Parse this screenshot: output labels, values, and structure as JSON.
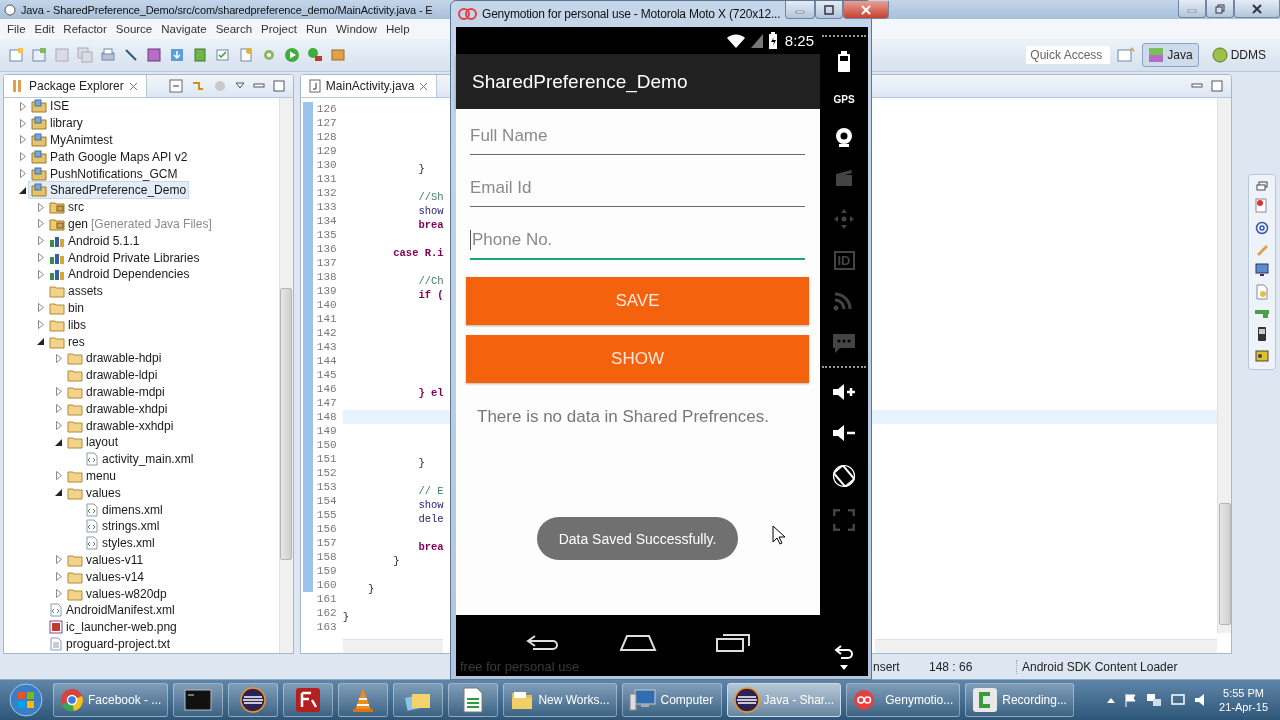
{
  "eclipse": {
    "title": "Java - SharedPreference_Demo/src/com/sharedpreference_demo/MainActivity.java - E",
    "menu": [
      "File",
      "Edit",
      "Refactor",
      "Source",
      "Navigate",
      "Search",
      "Project",
      "Run",
      "Window",
      "Help"
    ],
    "quick_access": {
      "placeholder": "Quick Access"
    },
    "perspectives": [
      {
        "label": "Java",
        "selected": true
      },
      {
        "label": "DDMS",
        "selected": false
      }
    ],
    "explorer": {
      "title": "Package Explorer",
      "tree": [
        {
          "label": "ISE",
          "kind": "project",
          "expandable": true,
          "expanded": false,
          "selected": false
        },
        {
          "label": "library",
          "kind": "project",
          "expandable": true,
          "expanded": false,
          "selected": false
        },
        {
          "label": "MyAnimtest",
          "kind": "project",
          "expandable": true,
          "expanded": false,
          "selected": false
        },
        {
          "label": "Path Google Maps API v2",
          "kind": "project",
          "expandable": true,
          "expanded": false,
          "selected": false
        },
        {
          "label": "PushNotifications_GCM",
          "kind": "project",
          "expandable": true,
          "expanded": false,
          "selected": false
        },
        {
          "label": "SharedPreference_Demo",
          "kind": "project",
          "expandable": true,
          "expanded": true,
          "selected": true,
          "children": [
            {
              "label": "src",
              "kind": "package-folder",
              "expandable": true,
              "expanded": false,
              "selected": false
            },
            {
              "label": "gen",
              "note": "[Generated Java Files]",
              "kind": "package-folder",
              "expandable": true,
              "expanded": false,
              "selected": false
            },
            {
              "label": "Android 5.1.1",
              "kind": "library",
              "expandable": true,
              "expanded": false,
              "selected": false
            },
            {
              "label": "Android Private Libraries",
              "kind": "library",
              "expandable": true,
              "expanded": false,
              "selected": false
            },
            {
              "label": "Android Dependencies",
              "kind": "library",
              "expandable": true,
              "expanded": false,
              "selected": false
            },
            {
              "label": "assets",
              "kind": "folder",
              "selected": false
            },
            {
              "label": "bin",
              "kind": "folder",
              "expandable": true,
              "expanded": false,
              "selected": false
            },
            {
              "label": "libs",
              "kind": "folder",
              "expandable": true,
              "expanded": false,
              "selected": false
            },
            {
              "label": "res",
              "kind": "folder",
              "expandable": true,
              "expanded": true,
              "selected": false,
              "children": [
                {
                  "label": "drawable-hdpi",
                  "kind": "folder",
                  "expandable": true,
                  "expanded": false,
                  "selected": false
                },
                {
                  "label": "drawable-ldpi",
                  "kind": "folder",
                  "selected": false
                },
                {
                  "label": "drawable-mdpi",
                  "kind": "folder",
                  "expandable": true,
                  "expanded": false,
                  "selected": false
                },
                {
                  "label": "drawable-xhdpi",
                  "kind": "folder",
                  "expandable": true,
                  "expanded": false,
                  "selected": false
                },
                {
                  "label": "drawable-xxhdpi",
                  "kind": "folder",
                  "expandable": true,
                  "expanded": false,
                  "selected": false
                },
                {
                  "label": "layout",
                  "kind": "folder",
                  "expandable": true,
                  "expanded": true,
                  "selected": false,
                  "children": [
                    {
                      "label": "activity_main.xml",
                      "kind": "file",
                      "selected": false
                    }
                  ]
                },
                {
                  "label": "menu",
                  "kind": "folder",
                  "expandable": true,
                  "expanded": false,
                  "selected": false
                },
                {
                  "label": "values",
                  "kind": "folder",
                  "expandable": true,
                  "expanded": true,
                  "selected": false,
                  "children": [
                    {
                      "label": "dimens.xml",
                      "kind": "file",
                      "selected": false
                    },
                    {
                      "label": "strings.xml",
                      "kind": "file",
                      "selected": false
                    },
                    {
                      "label": "styles.xml",
                      "kind": "file",
                      "selected": false
                    }
                  ]
                },
                {
                  "label": "values-v11",
                  "kind": "folder",
                  "expandable": true,
                  "expanded": false,
                  "selected": false
                },
                {
                  "label": "values-v14",
                  "kind": "folder",
                  "expandable": true,
                  "expanded": false,
                  "selected": false
                },
                {
                  "label": "values-w820dp",
                  "kind": "folder",
                  "expandable": true,
                  "expanded": false,
                  "selected": false
                }
              ]
            },
            {
              "label": "AndroidManifest.xml",
              "kind": "file",
              "selected": false
            },
            {
              "label": "ic_launcher-web.png",
              "kind": "image",
              "selected": false
            },
            {
              "label": "proguard-project.txt",
              "kind": "text",
              "selected": false
            }
          ]
        }
      ]
    },
    "editor": {
      "tab": "MainActivity.java",
      "lines": [
        {
          "number": "126",
          "changed": true,
          "current": false
        },
        {
          "number": "127",
          "changed": true,
          "current": false
        },
        {
          "number": "128",
          "changed": true,
          "current": false
        },
        {
          "number": "129",
          "changed": true,
          "current": false
        },
        {
          "number": "130",
          "code": "            }",
          "kind": "plain",
          "changed": true,
          "current": false
        },
        {
          "number": "131",
          "changed": true,
          "current": false
        },
        {
          "number": "132",
          "code": "            //Sh",
          "kind": "comment",
          "changed": true,
          "current": false
        },
        {
          "number": "133",
          "code": "            show",
          "kind": "method",
          "changed": true,
          "current": false
        },
        {
          "number": "134",
          "code": "            brea",
          "kind": "keyword",
          "changed": true,
          "current": false
        },
        {
          "number": "135",
          "changed": true,
          "current": false
        },
        {
          "number": "136",
          "code": "        case R.i",
          "kind": "keyword",
          "changed": true,
          "current": false
        },
        {
          "number": "137",
          "changed": true,
          "current": false
        },
        {
          "number": "138",
          "code": "            //Ch",
          "kind": "comment",
          "changed": true,
          "current": false
        },
        {
          "number": "139",
          "code": "            if (",
          "kind": "keyword",
          "changed": true,
          "current": false
        },
        {
          "number": "140",
          "changed": true,
          "current": false
        },
        {
          "number": "141",
          "changed": true,
          "current": false
        },
        {
          "number": "142",
          "changed": true,
          "current": false
        },
        {
          "number": "143",
          "changed": true,
          "current": false
        },
        {
          "number": "144",
          "changed": true,
          "current": false
        },
        {
          "number": "145",
          "changed": true,
          "current": false
        },
        {
          "number": "146",
          "code": "            } el",
          "kind": "keyword",
          "changed": true,
          "current": false
        },
        {
          "number": "147",
          "changed": true,
          "current": false
        },
        {
          "number": "148",
          "changed": true,
          "current": true
        },
        {
          "number": "149",
          "changed": true,
          "current": false
        },
        {
          "number": "150",
          "changed": true,
          "current": false
        },
        {
          "number": "151",
          "code": "            }",
          "kind": "plain",
          "changed": true,
          "current": false
        },
        {
          "number": "152",
          "changed": true,
          "current": false
        },
        {
          "number": "153",
          "code": "            // E",
          "kind": "comment",
          "changed": true,
          "current": false
        },
        {
          "number": "154",
          "code": "            show",
          "kind": "method",
          "changed": true,
          "current": false
        },
        {
          "number": "155",
          "code": "            dele",
          "kind": "method",
          "changed": true,
          "current": false
        },
        {
          "number": "156",
          "changed": true,
          "current": false
        },
        {
          "number": "157",
          "code": "            brea",
          "kind": "keyword",
          "changed": true,
          "current": false
        },
        {
          "number": "158",
          "code": "        }",
          "kind": "plain",
          "changed": true,
          "current": false
        },
        {
          "number": "159",
          "changed": true,
          "current": false
        },
        {
          "number": "160",
          "code": "    }",
          "kind": "plain",
          "changed": true,
          "current": false
        },
        {
          "number": "161",
          "changed": false,
          "current": false
        },
        {
          "number": "162",
          "code": "}",
          "kind": "plain",
          "changed": false,
          "current": false
        },
        {
          "number": "163",
          "changed": false,
          "current": false
        }
      ]
    },
    "status": {
      "mode": "nsert",
      "position": "148 : 66",
      "task": "Android SDK Content Loader"
    }
  },
  "emulator": {
    "title": "Genymotion for personal use - Motorola Moto X (720x12...",
    "clock": "8:25",
    "app_title": "SharedPreference_Demo",
    "fields": [
      {
        "placeholder": "Full Name",
        "focused": false
      },
      {
        "placeholder": "Email Id",
        "focused": false
      },
      {
        "placeholder": "Phone No.",
        "focused": true
      }
    ],
    "buttons": [
      "SAVE",
      "SHOW"
    ],
    "message": "There is no data in Shared Prefrences.",
    "toast": "Data Saved Successfully.",
    "watermark": "free for personal use",
    "tool_groups": [
      {
        "tools": [
          {
            "kind": "battery",
            "disabled": false
          },
          {
            "kind": "gps",
            "label": "GPS",
            "disabled": false
          },
          {
            "kind": "camera",
            "disabled": false
          },
          {
            "kind": "video",
            "disabled": true
          },
          {
            "kind": "dpad",
            "disabled": true
          },
          {
            "kind": "id",
            "label": "ID",
            "disabled": true
          },
          {
            "kind": "cast",
            "disabled": true
          },
          {
            "kind": "sms",
            "disabled": true
          }
        ]
      },
      {
        "tools": [
          {
            "kind": "volume-up",
            "disabled": false
          },
          {
            "kind": "volume-down",
            "disabled": false
          },
          {
            "kind": "rotate",
            "disabled": false
          },
          {
            "kind": "resize",
            "disabled": true
          }
        ]
      },
      {
        "tools": [
          {
            "kind": "back",
            "disabled": false
          }
        ]
      }
    ]
  },
  "taskbar": {
    "items": [
      {
        "kind": "chrome",
        "label": "Facebook - ...",
        "selected": false
      },
      {
        "kind": "terminal",
        "selected": false
      },
      {
        "kind": "eclipse",
        "selected": false
      },
      {
        "kind": "filezilla",
        "selected": false
      },
      {
        "kind": "vlc",
        "selected": false
      },
      {
        "kind": "folders",
        "selected": false
      },
      {
        "kind": "sheet",
        "selected": false
      },
      {
        "kind": "folder",
        "label": "New Works...",
        "selected": false
      },
      {
        "kind": "computer",
        "label": "Computer",
        "selected": false
      },
      {
        "kind": "eclipse",
        "label": "Java - Shar...",
        "selected": true
      },
      {
        "kind": "genymotion",
        "label": "Genymotio...",
        "selected": false
      },
      {
        "kind": "camtasia",
        "label": "Recording...",
        "selected": false
      }
    ],
    "time": "5:55 PM",
    "date": "21-Apr-15"
  }
}
